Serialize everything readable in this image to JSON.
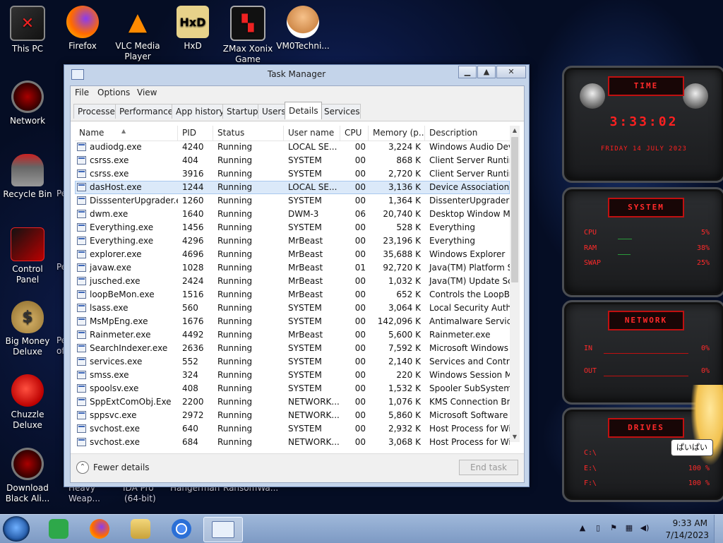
{
  "desktop": {
    "icons": [
      {
        "label": "This PC",
        "icon": "computer-icon"
      },
      {
        "label": "Firefox",
        "icon": "firefox-icon"
      },
      {
        "label": "VLC Media Player",
        "icon": "vlc-icon"
      },
      {
        "label": "HxD",
        "icon": "hxd-icon"
      },
      {
        "label": "ZMax Xonix Game",
        "icon": "zmax-icon"
      },
      {
        "label": "VM0Techni...",
        "icon": "doctor-icon"
      },
      {
        "label": "Network",
        "icon": "network-icon"
      },
      {
        "label": "Recycle Bin",
        "icon": "recycle-bin-icon"
      },
      {
        "label": "Control Panel",
        "icon": "control-panel-icon"
      },
      {
        "label": "Big Money Deluxe",
        "icon": "money-bag-icon"
      },
      {
        "label": "Chuzzle Deluxe",
        "icon": "chuzzle-icon"
      },
      {
        "label": "Download Black Ali...",
        "icon": "alien-icon"
      }
    ],
    "partial_labels": [
      "Heavy",
      "Weap...",
      "IDA Pro",
      "(64-bit)",
      "Hangerman",
      "RansomWa...",
      "Pe",
      "Pe",
      "Pe",
      "of"
    ]
  },
  "widgets": {
    "time": {
      "title": "TIME",
      "clock": "3:33:02",
      "date": "FRIDAY 14 JULY 2023"
    },
    "system": {
      "title": "SYSTEM",
      "rows": [
        {
          "label": "CPU",
          "value": "5%"
        },
        {
          "label": "RAM",
          "value": "38%"
        },
        {
          "label": "SWAP",
          "value": "25%"
        }
      ]
    },
    "network": {
      "title": "NETWORK",
      "rows": [
        {
          "label": "IN",
          "value": "0%"
        },
        {
          "label": "OUT",
          "value": "0%"
        }
      ]
    },
    "drives": {
      "title": "DRIVES",
      "rows": [
        {
          "label": "C:\\",
          "value": ""
        },
        {
          "label": "E:\\",
          "value": "100 %"
        },
        {
          "label": "F:\\",
          "value": "100 %"
        }
      ]
    },
    "character_bubble": "ぱいぱい"
  },
  "window": {
    "title": "Task Manager",
    "menu": [
      "File",
      "Options",
      "View"
    ],
    "tabs": [
      "Processes",
      "Performance",
      "App history",
      "Startup",
      "Users",
      "Details",
      "Services"
    ],
    "active_tab": "Details",
    "columns": [
      "Name",
      "PID",
      "Status",
      "User name",
      "CPU",
      "Memory (p...",
      "Description"
    ],
    "sorted_column": "Name",
    "rows": [
      {
        "name": "audiodg.exe",
        "pid": "4240",
        "status": "Running",
        "user": "LOCAL SE...",
        "cpu": "00",
        "mem": "3,224 K",
        "desc": "Windows Audio Dev..."
      },
      {
        "name": "csrss.exe",
        "pid": "404",
        "status": "Running",
        "user": "SYSTEM",
        "cpu": "00",
        "mem": "868 K",
        "desc": "Client Server Runtim..."
      },
      {
        "name": "csrss.exe",
        "pid": "3916",
        "status": "Running",
        "user": "SYSTEM",
        "cpu": "00",
        "mem": "2,720 K",
        "desc": "Client Server Runtim..."
      },
      {
        "name": "dasHost.exe",
        "pid": "1244",
        "status": "Running",
        "user": "LOCAL SE...",
        "cpu": "00",
        "mem": "3,136 K",
        "desc": "Device Association F..."
      },
      {
        "name": "DisssenterUpgrader.exe",
        "pid": "1260",
        "status": "Running",
        "user": "SYSTEM",
        "cpu": "00",
        "mem": "1,364 K",
        "desc": "DissenterUpgrader"
      },
      {
        "name": "dwm.exe",
        "pid": "1640",
        "status": "Running",
        "user": "DWM-3",
        "cpu": "06",
        "mem": "20,740 K",
        "desc": "Desktop Window M..."
      },
      {
        "name": "Everything.exe",
        "pid": "1456",
        "status": "Running",
        "user": "SYSTEM",
        "cpu": "00",
        "mem": "528 K",
        "desc": "Everything"
      },
      {
        "name": "Everything.exe",
        "pid": "4296",
        "status": "Running",
        "user": "MrBeast",
        "cpu": "00",
        "mem": "23,196 K",
        "desc": "Everything"
      },
      {
        "name": "explorer.exe",
        "pid": "4696",
        "status": "Running",
        "user": "MrBeast",
        "cpu": "00",
        "mem": "35,688 K",
        "desc": "Windows Explorer"
      },
      {
        "name": "javaw.exe",
        "pid": "1028",
        "status": "Running",
        "user": "MrBeast",
        "cpu": "01",
        "mem": "92,720 K",
        "desc": "Java(TM) Platform S..."
      },
      {
        "name": "jusched.exe",
        "pid": "2424",
        "status": "Running",
        "user": "MrBeast",
        "cpu": "00",
        "mem": "1,032 K",
        "desc": "Java(TM) Update Sc..."
      },
      {
        "name": "loopBeMon.exe",
        "pid": "1516",
        "status": "Running",
        "user": "MrBeast",
        "cpu": "00",
        "mem": "652 K",
        "desc": "Controls the LoopBe..."
      },
      {
        "name": "lsass.exe",
        "pid": "560",
        "status": "Running",
        "user": "SYSTEM",
        "cpu": "00",
        "mem": "3,064 K",
        "desc": "Local Security Auth..."
      },
      {
        "name": "MsMpEng.exe",
        "pid": "1676",
        "status": "Running",
        "user": "SYSTEM",
        "cpu": "00",
        "mem": "142,096 K",
        "desc": "Antimalware Service..."
      },
      {
        "name": "Rainmeter.exe",
        "pid": "4492",
        "status": "Running",
        "user": "MrBeast",
        "cpu": "00",
        "mem": "5,600 K",
        "desc": "Rainmeter.exe"
      },
      {
        "name": "SearchIndexer.exe",
        "pid": "2636",
        "status": "Running",
        "user": "SYSTEM",
        "cpu": "00",
        "mem": "7,592 K",
        "desc": "Microsoft Windows ..."
      },
      {
        "name": "services.exe",
        "pid": "552",
        "status": "Running",
        "user": "SYSTEM",
        "cpu": "00",
        "mem": "2,140 K",
        "desc": "Services and Control..."
      },
      {
        "name": "smss.exe",
        "pid": "324",
        "status": "Running",
        "user": "SYSTEM",
        "cpu": "00",
        "mem": "220 K",
        "desc": "Windows Session M..."
      },
      {
        "name": "spoolsv.exe",
        "pid": "408",
        "status": "Running",
        "user": "SYSTEM",
        "cpu": "00",
        "mem": "1,532 K",
        "desc": "Spooler SubSystem ..."
      },
      {
        "name": "SppExtComObj.Exe",
        "pid": "2200",
        "status": "Running",
        "user": "NETWORK...",
        "cpu": "00",
        "mem": "1,076 K",
        "desc": "KMS Connection Br..."
      },
      {
        "name": "sppsvc.exe",
        "pid": "2972",
        "status": "Running",
        "user": "NETWORK...",
        "cpu": "00",
        "mem": "5,860 K",
        "desc": "Microsoft Software ..."
      },
      {
        "name": "svchost.exe",
        "pid": "640",
        "status": "Running",
        "user": "SYSTEM",
        "cpu": "00",
        "mem": "2,932 K",
        "desc": "Host Process for Wi..."
      },
      {
        "name": "svchost.exe",
        "pid": "684",
        "status": "Running",
        "user": "NETWORK...",
        "cpu": "00",
        "mem": "3,068 K",
        "desc": "Host Process for Wi..."
      }
    ],
    "selected_row": 3,
    "fewer_details": "Fewer details",
    "end_task": "End task",
    "buttons": {
      "minimize": "▁",
      "maximize": "▲",
      "close": "✕"
    }
  },
  "taskbar": {
    "clock_time": "9:33 AM",
    "clock_date": "7/14/2023",
    "pinned": [
      "notes-icon",
      "firefox-icon",
      "file-explorer-icon",
      "chrome-icon",
      "task-manager-icon"
    ]
  },
  "colors": {
    "accent_red": "#ff2a2a",
    "selection": "#dbe9f9",
    "taskbar": "#8fa9d0"
  }
}
